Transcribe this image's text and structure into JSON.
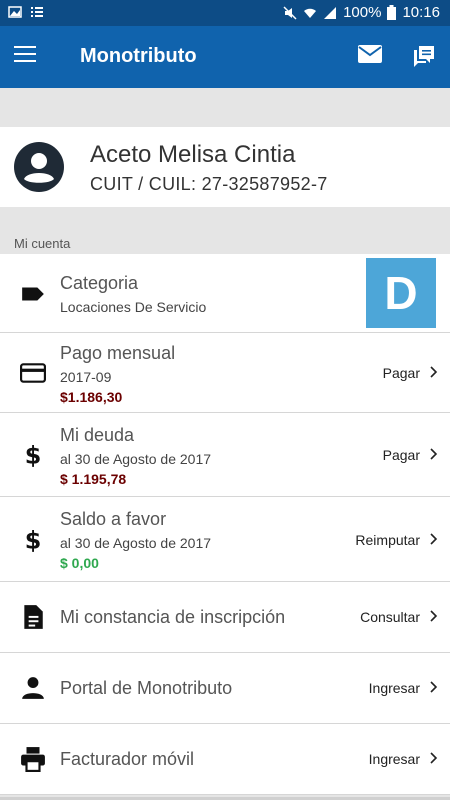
{
  "status": {
    "battery": "100%",
    "time": "10:16"
  },
  "appbar": {
    "title": "Monotributo",
    "menu_icon": "menu-icon",
    "mail_icon": "mail-icon",
    "chat_icon": "chat-icon"
  },
  "profile": {
    "name": "Aceto Melisa Cintia",
    "cuit": "CUIT / CUIL: 27-32587952-7"
  },
  "section_label": "Mi cuenta",
  "items": [
    {
      "title": "Categoria",
      "subtitle": "Locaciones De Servicio",
      "badge": "D"
    },
    {
      "title": "Pago mensual",
      "subtitle": "2017-09",
      "amount": "$1.186,30",
      "action": "Pagar"
    },
    {
      "title": "Mi deuda",
      "subtitle": "al 30 de Agosto de 2017",
      "amount": "$ 1.195,78",
      "action": "Pagar"
    },
    {
      "title": "Saldo a favor",
      "subtitle": "al 30 de Agosto de 2017",
      "amount": "$ 0,00",
      "action": "Reimputar"
    },
    {
      "title": "Mi constancia de inscripción",
      "action": "Consultar"
    },
    {
      "title": "Portal de Monotributo",
      "action": "Ingresar"
    },
    {
      "title": "Facturador móvil",
      "action": "Ingresar"
    }
  ],
  "colors": {
    "appbar": "#1063ad",
    "statusbar": "#0d4c86",
    "badge": "#4da6d8",
    "amount": "#6b0000",
    "amount_positive": "#2fa84f"
  }
}
